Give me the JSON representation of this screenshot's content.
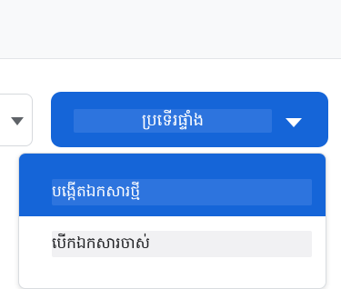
{
  "primary_select": {
    "label": "ប្រទើរផ្ទាំង",
    "accent_color": "#1565d8",
    "icon": "chevron-down-icon"
  },
  "secondary_select": {
    "icon": "chevron-down-icon"
  },
  "dropdown": {
    "items": [
      {
        "label": "បង្កើតឯកសារថ្មី",
        "selected": true
      },
      {
        "label": "បើកឯកសារចាស់",
        "selected": false
      }
    ]
  }
}
